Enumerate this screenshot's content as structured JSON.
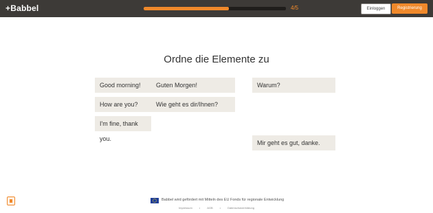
{
  "header": {
    "logo_text": "+Babbel",
    "progress": {
      "current": 4,
      "total": 5,
      "label": "4/5",
      "fill_fraction": 0.6
    },
    "login_label": "Einloggen",
    "register_label": "Registrierung",
    "accent_color": "#f0892b",
    "bar_color": "#3d3a37"
  },
  "main": {
    "title": "Ordne die Elemente zu",
    "tiles": [
      {
        "text": "Good morning!"
      },
      {
        "text": "Guten Morgen!"
      },
      {
        "text": "Warum?"
      },
      {
        "text": "How are you?"
      },
      {
        "text": "Wie geht es dir/Ihnen?"
      },
      {
        "text": "I'm fine, thank you."
      },
      {
        "text": "Mir geht es gut, danke."
      }
    ],
    "tile_color": "#eeebe5"
  },
  "footer": {
    "funding_text": "Babbel wird gefördert mit Mitteln des EU Fonds für regionale Entwicklung",
    "flag_icon": "eu-flag-icon",
    "links": [
      "Impressum",
      "AGB",
      "Datenschutzerklärung"
    ],
    "separator": "•"
  },
  "side": {
    "icon": "feedback-icon"
  }
}
